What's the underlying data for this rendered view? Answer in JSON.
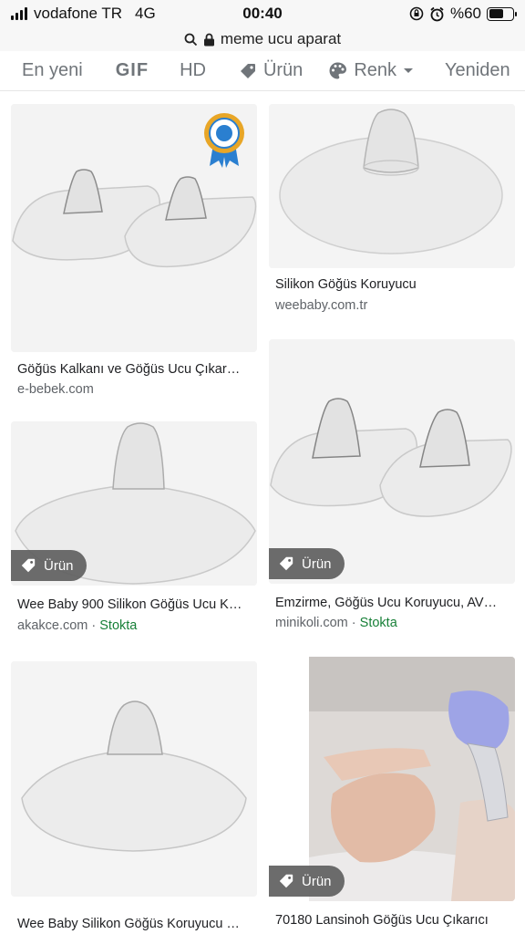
{
  "status_bar": {
    "carrier": "vodafone TR",
    "network": "4G",
    "time": "00:40",
    "battery": "%60",
    "battery_level": 0.6
  },
  "url_bar": {
    "query": "meme ucu aparat",
    "icons": [
      "search-icon",
      "lock-icon"
    ]
  },
  "filters": [
    {
      "label": "En yeni"
    },
    {
      "label": "GIF"
    },
    {
      "label": "HD"
    },
    {
      "label": "Ürün",
      "icon": "tag-icon"
    },
    {
      "label": "Renk",
      "icon": "palette-icon"
    },
    {
      "label": "Yeniden"
    }
  ],
  "results": [
    {
      "title": "Göğüs Kalkanı ve Göğüs Ucu Çıkar…",
      "source": "e-bebek.com",
      "stock": "",
      "badge": "",
      "award_icon": "award-ribbon-icon"
    },
    {
      "title": "Silikon Göğüs Koruyucu",
      "source": "weebaby.com.tr",
      "stock": "",
      "badge": ""
    },
    {
      "title": "Wee Baby 900 Silikon Göğüs Ucu K…",
      "source": "akakce.com · ",
      "stock": "Stokta",
      "badge": "Ürün"
    },
    {
      "title": "Emzirme, Göğüs Ucu Koruyucu, AV…",
      "source": "minikoli.com · ",
      "stock": "Stokta",
      "badge": "Ürün"
    },
    {
      "title": "Wee Baby Silikon Göğüs Koruyucu …",
      "source": "",
      "stock": "",
      "badge": ""
    },
    {
      "title": "70180 Lansinoh Göğüs Ucu Çıkarıcı",
      "source": "",
      "stock": "",
      "badge": "Ürün"
    }
  ],
  "colors": {
    "stock_green": "#188038",
    "chip_gray": "#70757a",
    "badge_bg": "#5f5f5f"
  }
}
